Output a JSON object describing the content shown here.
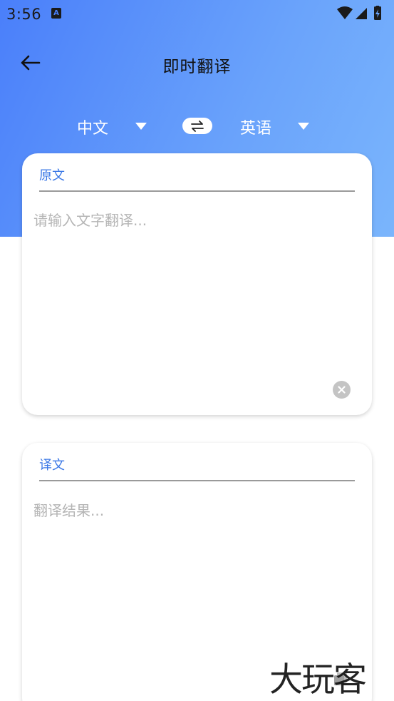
{
  "status_bar": {
    "time": "3:56",
    "notification_icon": "a-notification-icon",
    "wifi_icon": "wifi-icon",
    "signal_icon": "cell-signal-icon",
    "battery_icon": "battery-charging-icon"
  },
  "app_bar": {
    "title": "即时翻译",
    "back_icon": "arrow-left-icon"
  },
  "languages": {
    "source": "中文",
    "target": "英语",
    "swap_icon": "swap-arrows-icon",
    "dropdown_icon": "triangle-down-icon"
  },
  "source_card": {
    "label": "原文",
    "placeholder": "请输入文字翻译...",
    "value": "",
    "clear_icon": "clear-circle-icon"
  },
  "target_card": {
    "label": "译文",
    "placeholder": "翻译结果...",
    "copy_icon": "copy-icon"
  },
  "watermark": "大玩客",
  "colors": {
    "header_gradient_start": "#4a7ffa",
    "header_gradient_end": "#7ab5fc",
    "accent": "#3b78e6",
    "placeholder": "#b5b5b5"
  }
}
